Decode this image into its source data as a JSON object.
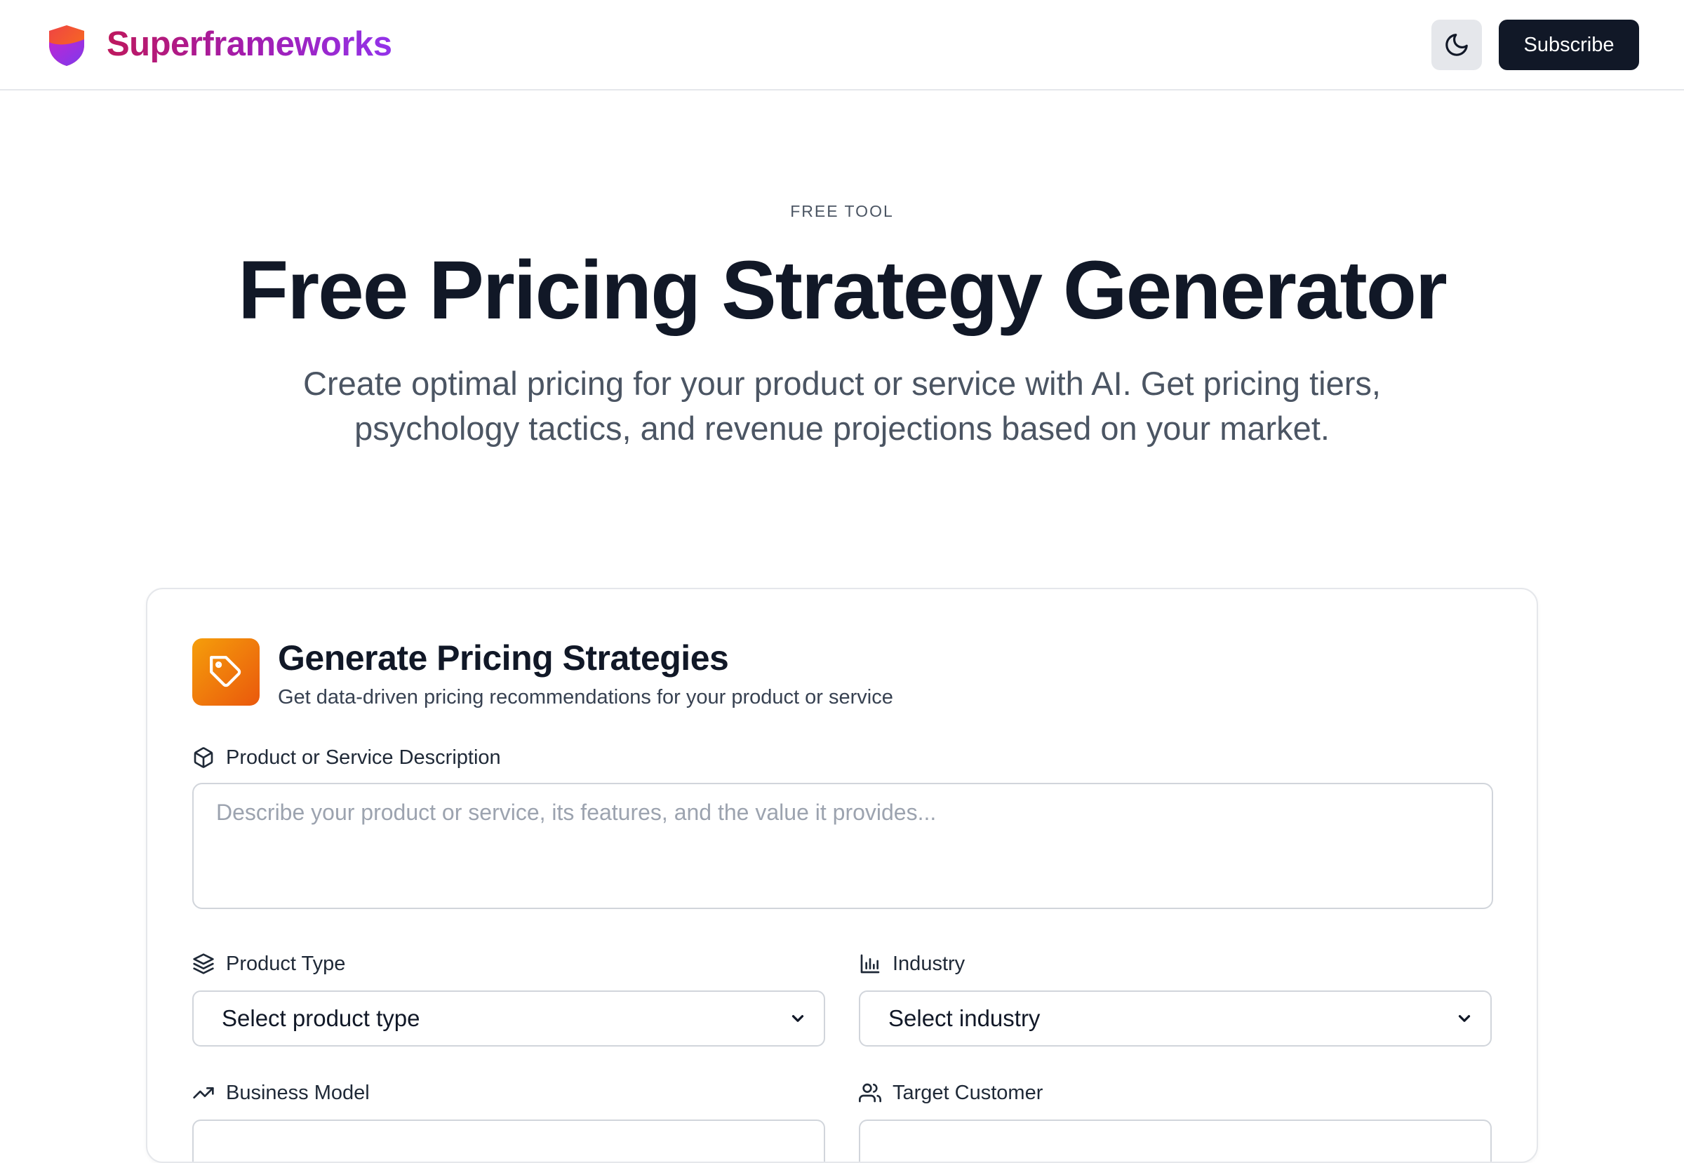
{
  "header": {
    "brand": "Superframeworks",
    "theme_toggle_icon": "moon-icon",
    "subscribe_label": "Subscribe"
  },
  "hero": {
    "eyebrow": "FREE TOOL",
    "title": "Free Pricing Strategy Generator",
    "subtitle": "Create optimal pricing for your product or service with AI. Get pricing tiers, psychology tactics, and revenue projections based on your market."
  },
  "card": {
    "icon": "tag-icon",
    "title": "Generate Pricing Strategies",
    "subtitle": "Get data-driven pricing recommendations for your product or service",
    "fields": {
      "description": {
        "label": "Product or Service Description",
        "icon": "package-icon",
        "placeholder": "Describe your product or service, its features, and the value it provides...",
        "value": ""
      },
      "product_type": {
        "label": "Product Type",
        "icon": "layers-icon",
        "selected": "Select product type"
      },
      "industry": {
        "label": "Industry",
        "icon": "bar-chart-icon",
        "selected": "Select industry"
      },
      "business_model": {
        "label": "Business Model",
        "icon": "trending-up-icon"
      },
      "target_customer": {
        "label": "Target Customer",
        "icon": "users-icon"
      }
    }
  },
  "colors": {
    "brand_gradient_start": "#be185d",
    "brand_gradient_end": "#9333ea",
    "accent_orange": "#f59e0b",
    "dark_button": "#111827"
  }
}
